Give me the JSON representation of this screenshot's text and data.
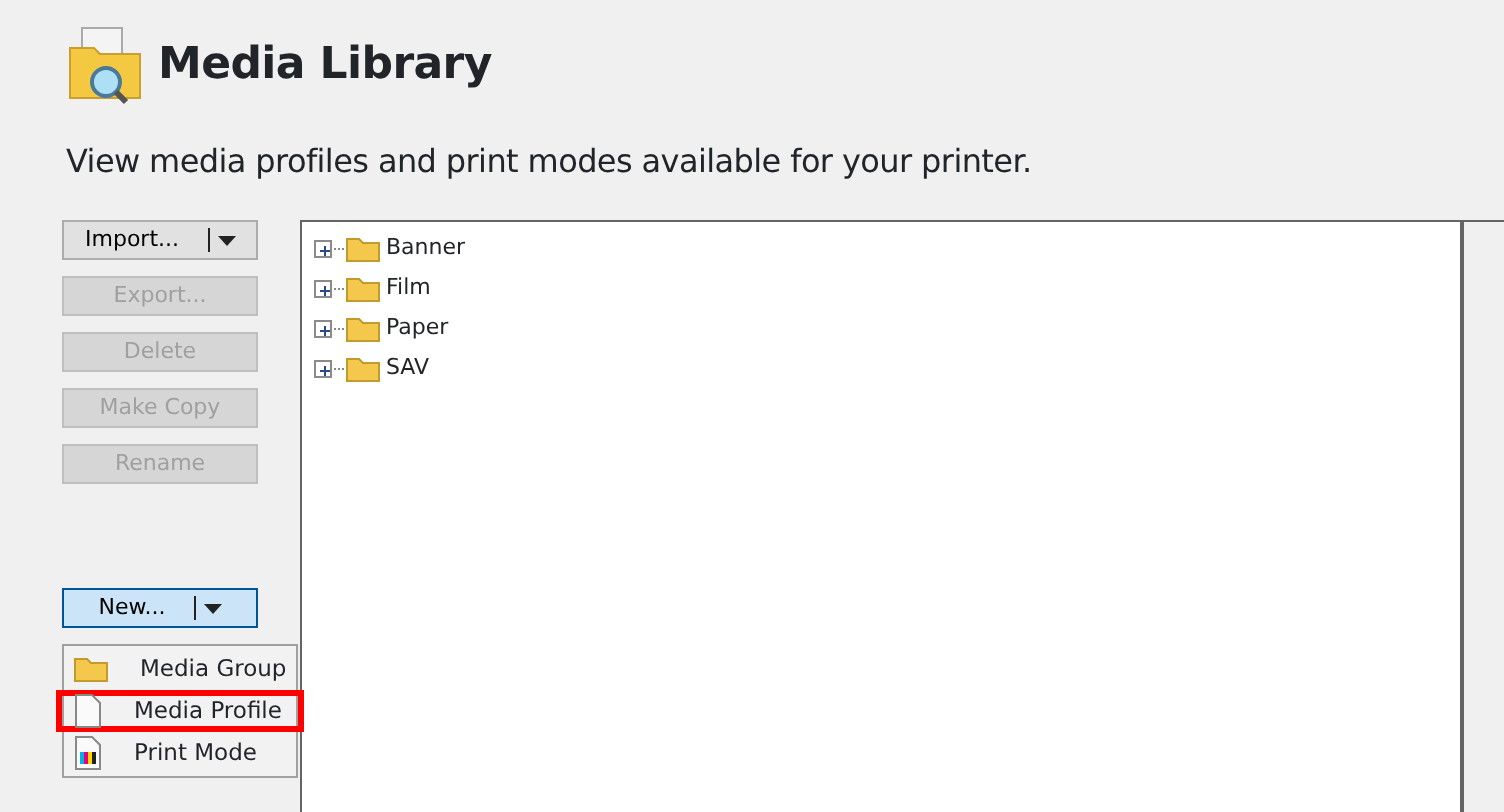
{
  "header": {
    "title": "Media Library",
    "subtitle": "View media profiles and print modes available for your printer."
  },
  "actions": [
    {
      "label": "Import...",
      "kind": "split",
      "disabled": false,
      "active": false
    },
    {
      "label": "Export...",
      "kind": "plain",
      "disabled": true,
      "active": false
    },
    {
      "label": "Delete",
      "kind": "plain",
      "disabled": true,
      "active": false
    },
    {
      "label": "Make Copy",
      "kind": "plain",
      "disabled": true,
      "active": false
    },
    {
      "label": "Rename",
      "kind": "plain",
      "disabled": true,
      "active": false
    }
  ],
  "new_button": {
    "label": "New...",
    "active": true
  },
  "new_menu": [
    {
      "label": "Media Group",
      "kind": "folder",
      "highlighted": false
    },
    {
      "label": "Media Profile",
      "kind": "document",
      "highlighted": true
    },
    {
      "label": "Print Mode",
      "kind": "printmode",
      "highlighted": false
    }
  ],
  "tree": [
    {
      "label": "Banner",
      "expanded": false
    },
    {
      "label": "Film",
      "expanded": false
    },
    {
      "label": "Paper",
      "expanded": false
    },
    {
      "label": "SAV",
      "expanded": false
    }
  ]
}
